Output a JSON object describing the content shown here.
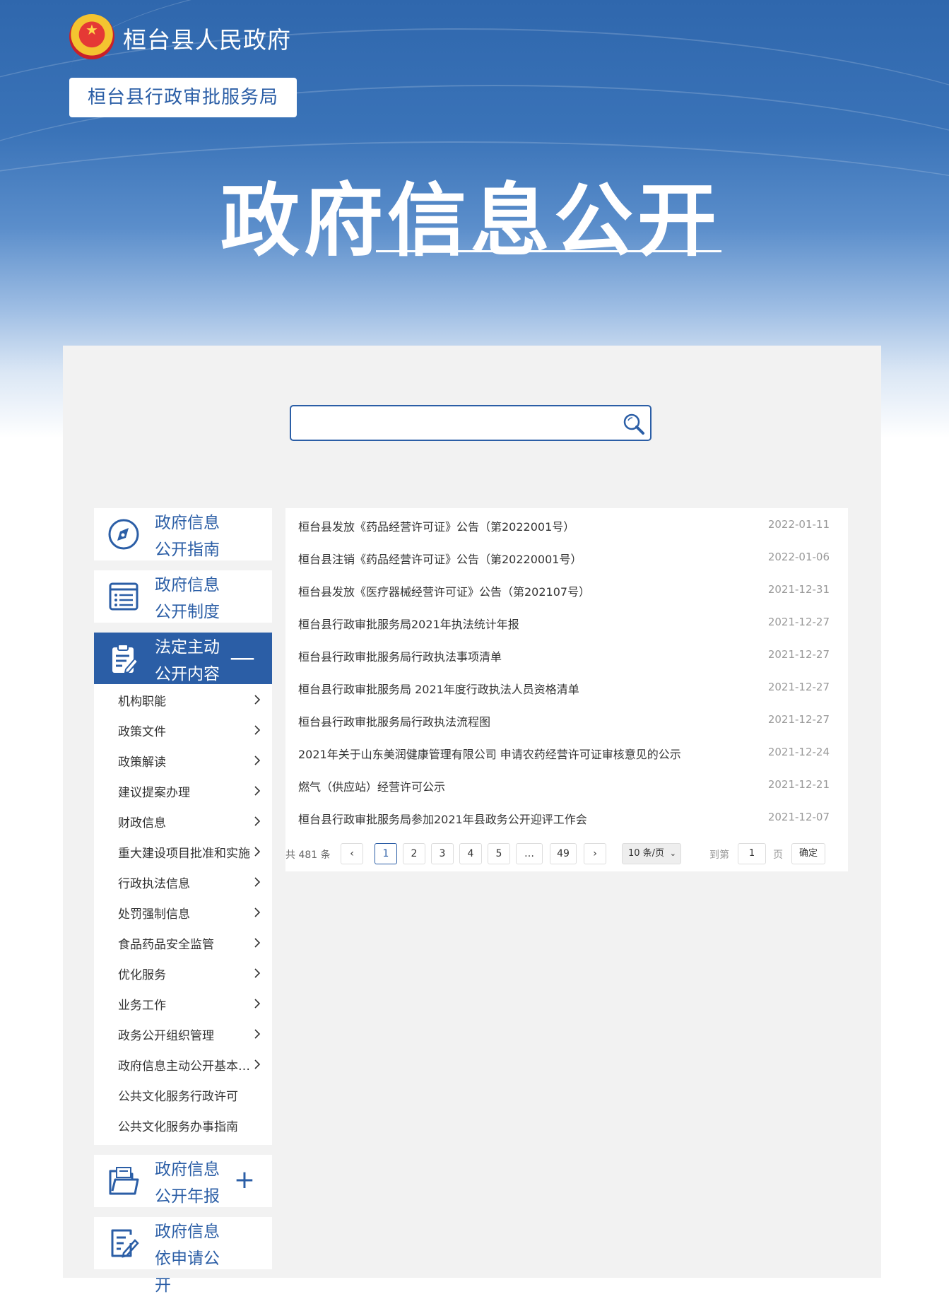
{
  "header": {
    "site_title": "桓台县人民政府",
    "department": "桓台县行政审批服务局",
    "banner_title": "政府信息公开"
  },
  "search": {
    "placeholder": ""
  },
  "sidebar": {
    "cards": [
      {
        "line1": "政府信息",
        "line2": "公开指南",
        "icon": "compass-icon"
      },
      {
        "line1": "政府信息",
        "line2": "公开制度",
        "icon": "list-icon"
      },
      {
        "line1": "法定主动",
        "line2": "公开内容",
        "icon": "clipboard-edit-icon",
        "toggle": "—",
        "active": true
      },
      {
        "line1": "政府信息",
        "line2": "公开年报",
        "icon": "folder-icon",
        "toggle": "+"
      },
      {
        "line1": "政府信息",
        "line2": "依申请公开",
        "icon": "edit-form-icon"
      }
    ],
    "submenu": [
      "机构职能",
      "政策文件",
      "政策解读",
      "建议提案办理",
      "财政信息",
      "重大建设项目批准和实施",
      "行政执法信息",
      "处罚强制信息",
      "食品药品安全监管",
      "优化服务",
      "业务工作",
      "政务公开组织管理",
      "政府信息主动公开基本目录",
      "公共文化服务行政许可",
      "公共文化服务办事指南"
    ]
  },
  "articles": [
    {
      "title": "桓台县发放《药品经营许可证》公告（第2022001号）",
      "date": "2022-01-11"
    },
    {
      "title": "桓台县注销《药品经营许可证》公告（第20220001号）",
      "date": "2022-01-06"
    },
    {
      "title": "桓台县发放《医疗器械经营许可证》公告（第202107号）",
      "date": "2021-12-31"
    },
    {
      "title": "桓台县行政审批服务局2021年执法统计年报",
      "date": "2021-12-27"
    },
    {
      "title": "桓台县行政审批服务局行政执法事项清单",
      "date": "2021-12-27"
    },
    {
      "title": "桓台县行政审批服务局 2021年度行政执法人员资格清单",
      "date": "2021-12-27"
    },
    {
      "title": "桓台县行政审批服务局行政执法流程图",
      "date": "2021-12-27"
    },
    {
      "title": "2021年关于山东美润健康管理有限公司 申请农药经营许可证审核意见的公示",
      "date": "2021-12-24"
    },
    {
      "title": "燃气（供应站）经营许可公示",
      "date": "2021-12-21"
    },
    {
      "title": "桓台县行政审批服务局参加2021年县政务公开迎评工作会",
      "date": "2021-12-07"
    }
  ],
  "pagination": {
    "total_text": "共 481 条",
    "prev": "‹",
    "next": "›",
    "pages": [
      "1",
      "2",
      "3",
      "4",
      "5",
      "…",
      "49"
    ],
    "current": "1",
    "page_size": "10 条/页",
    "goto_label": "到第",
    "goto_value": "1",
    "page_unit": "页",
    "confirm": "确定"
  },
  "colors": {
    "brand_blue": "#2b5ea6",
    "panel_bg": "#f2f2f2"
  }
}
